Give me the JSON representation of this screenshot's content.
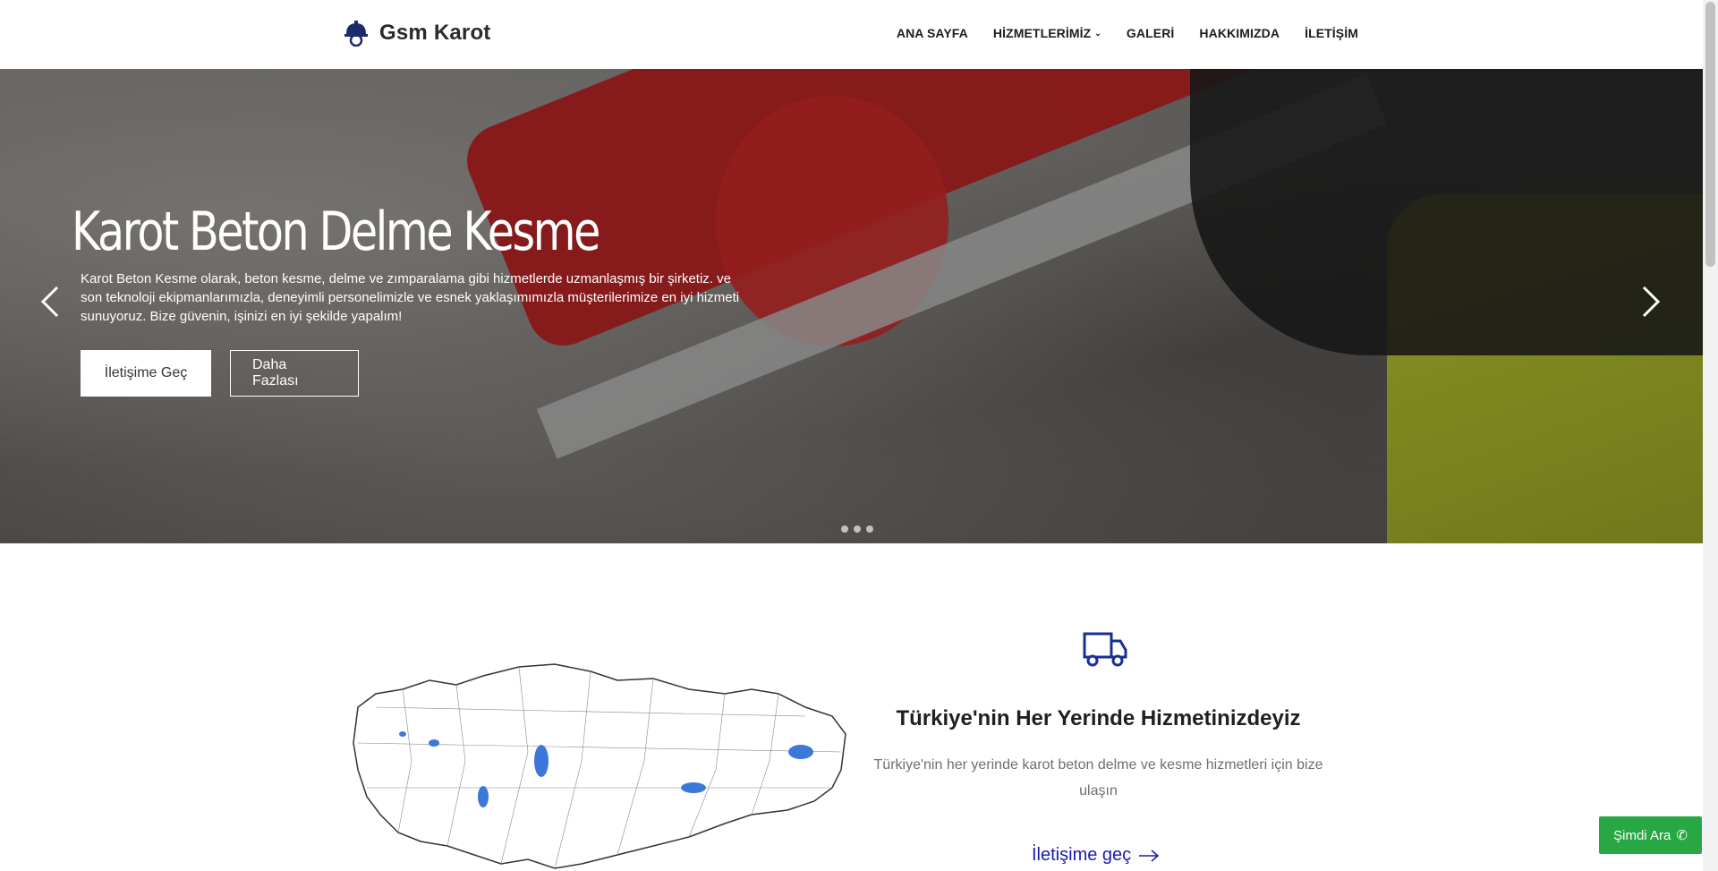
{
  "header": {
    "brand": "Gsm Karot",
    "nav": [
      {
        "label": "ANA SAYFA"
      },
      {
        "label": "HİZMETLERİMİZ"
      },
      {
        "label": "GALERİ"
      },
      {
        "label": "HAKKIMIZDA"
      },
      {
        "label": "İLETİŞİM"
      }
    ]
  },
  "hero": {
    "title": "Karot Beton Delme Kesme",
    "text": "Karot Beton Kesme olarak, beton kesme, delme ve zımparalama gibi hizmetlerde uzmanlaşmış bir şirketiz. ve son teknoloji ekipmanlarımızla, deneyimli personelimizle ve esnek yaklaşımımızla müşterilerimize en iyi hizmeti sunuyoruz. Bize güvenin, işinizi en iyi şekilde yapalım!",
    "primary_button": "İletişime Geç",
    "secondary_button": "Daha Fazlası",
    "slide_count": 3
  },
  "section": {
    "title": "Türkiye'nin Her Yerinde Hizmetinizdeyiz",
    "text": "Türkiye'nin her yerinde karot beton delme ve kesme hizmetleri için bize ulaşın",
    "link": "İletişime geç"
  },
  "call_button": "Şimdi Ara",
  "colors": {
    "accent": "#1a1aad",
    "call_green": "#28a745",
    "drill_red": "#b71c1c"
  },
  "icons": [
    "helmet-logo-icon",
    "chevron-down-icon",
    "arrow-left-icon",
    "arrow-right-icon",
    "truck-icon",
    "arrow-right-link-icon",
    "phone-icon"
  ]
}
